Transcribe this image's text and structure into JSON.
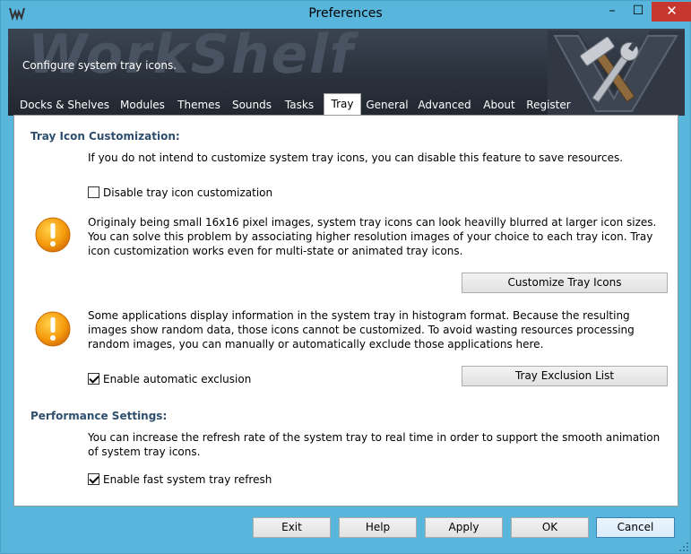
{
  "window": {
    "title": "Preferences"
  },
  "banner": {
    "subtitle": "Configure system tray icons.",
    "watermark": "WorkShelf"
  },
  "tabs": [
    "Docks & Shelves",
    "Modules",
    "Themes",
    "Sounds",
    "Tasks",
    "Tray",
    "General",
    "Advanced",
    "About",
    "Register"
  ],
  "tray": {
    "customization_title": "Tray Icon Customization:",
    "intro": "If you do not intend to customize system tray icons, you can disable this feature to save resources.",
    "disable_label": "Disable tray icon customization",
    "disable_checked": false,
    "info1": "Originaly being small 16x16 pixel images, system tray icons can look heavilly blurred at larger icon sizes. You can solve this problem by associating higher resolution images of your choice to each tray icon. Tray icon customization works even for multi-state or animated tray icons.",
    "customize_button": "Customize Tray Icons",
    "info2": "Some applications display information in the system tray in histogram format. Because the resulting images show random data, those icons cannot be customized. To avoid wasting resources processing random images, you can manually or automatically exclude those applications here.",
    "auto_exclusion_label": "Enable automatic exclusion",
    "auto_exclusion_checked": true,
    "exclusion_button": "Tray Exclusion List",
    "performance_title": "Performance Settings:",
    "performance_text": "You can increase the refresh rate of the system tray to real time in order to support the smooth animation of system tray icons.",
    "fast_refresh_label": "Enable fast system tray refresh",
    "fast_refresh_checked": true
  },
  "footer": {
    "exit": "Exit",
    "help": "Help",
    "apply": "Apply",
    "ok": "OK",
    "cancel": "Cancel"
  },
  "colors": {
    "frame": "#58b5dc",
    "close": "#c7372f",
    "section_title": "#2f4f6f",
    "banner": "#2b323d"
  },
  "icons": {
    "app": "workshelf-logo-icon",
    "warning": "exclamation-icon",
    "logo": "hammer-wrench-icon"
  }
}
